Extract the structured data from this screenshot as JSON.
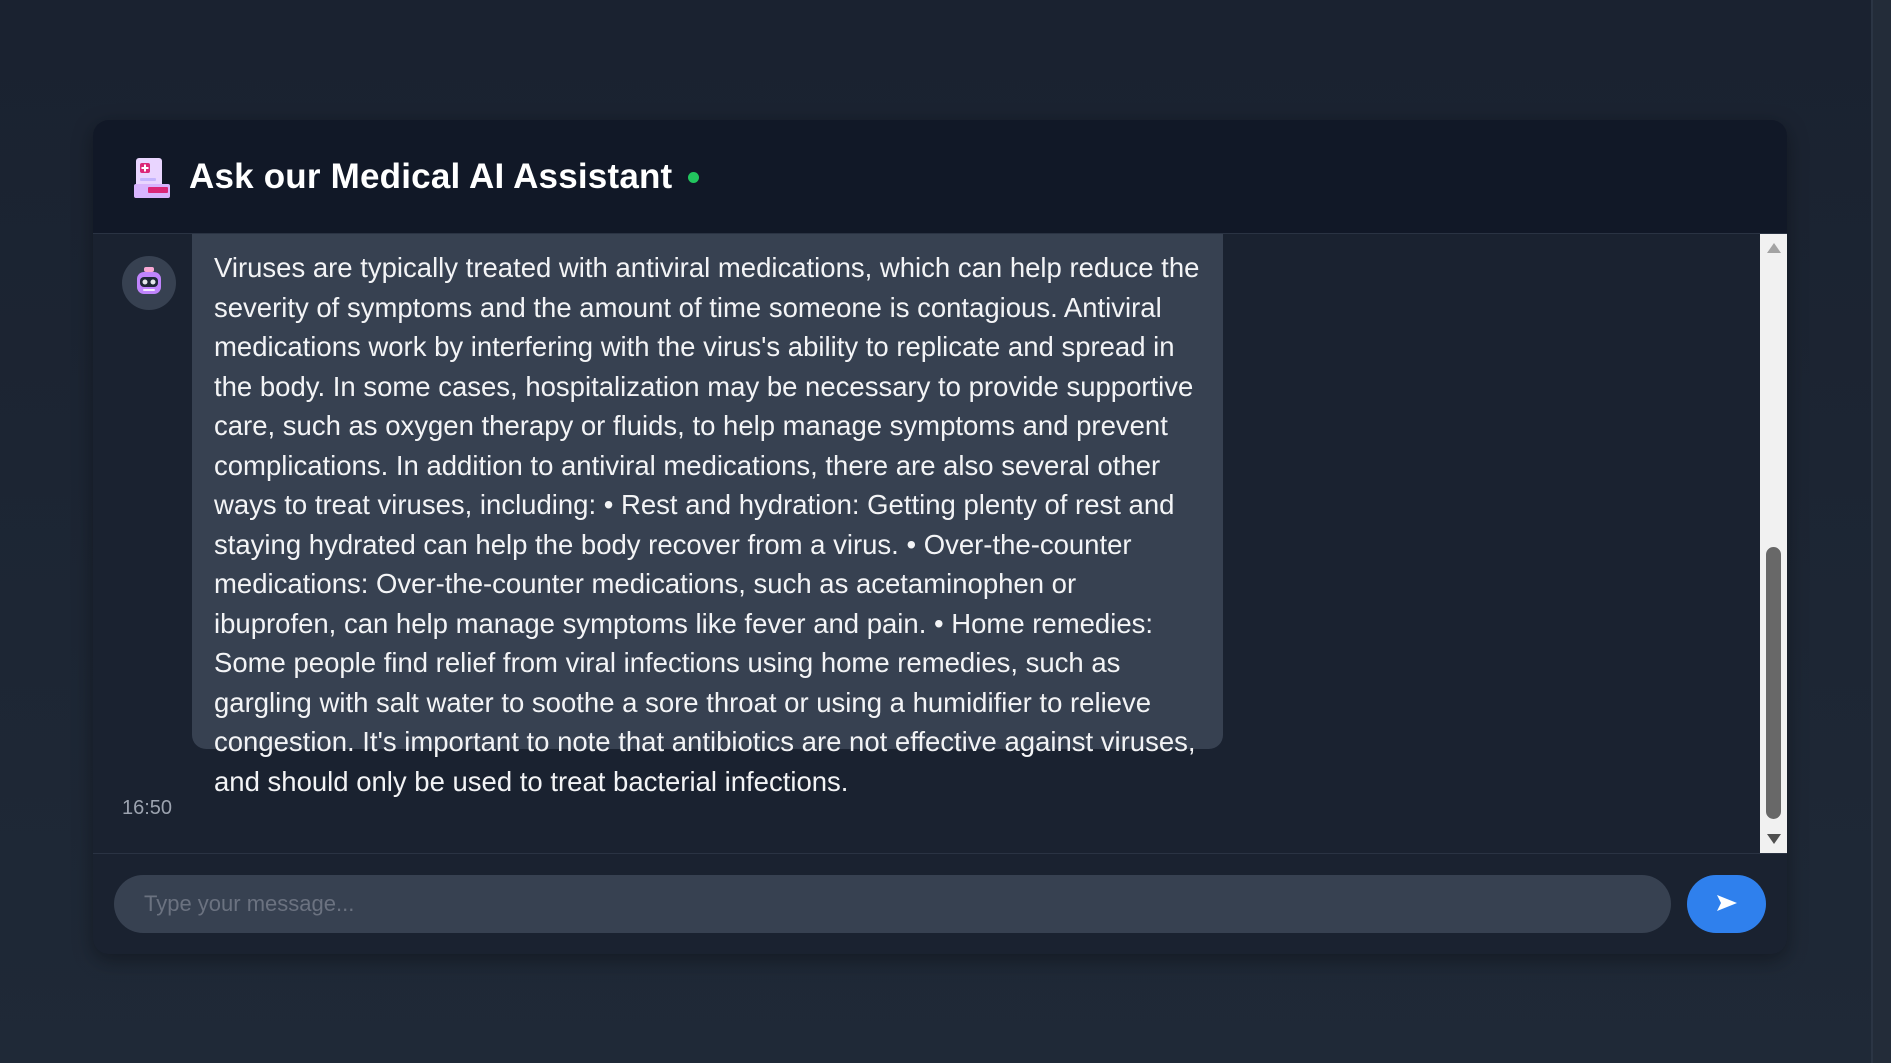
{
  "header": {
    "title": "Ask our Medical AI Assistant",
    "icon": "medical-kit-icon",
    "status": "online",
    "status_color": "#22c55e"
  },
  "conversation": {
    "messages": [
      {
        "sender": "assistant",
        "avatar_icon": "robot-icon",
        "text": "Viruses are typically treated with antiviral medications, which can help reduce the severity of symptoms and the amount of time someone is contagious. Antiviral medications work by interfering with the virus's ability to replicate and spread in the body. In some cases, hospitalization may be necessary to provide supportive care, such as oxygen therapy or fluids, to help manage symptoms and prevent complications. In addition to antiviral medications, there are also several other ways to treat viruses, including: • Rest and hydration: Getting plenty of rest and staying hydrated can help the body recover from a virus. • Over-the-counter medications: Over-the-counter medications, such as acetaminophen or ibuprofen, can help manage symptoms like fever and pain. • Home remedies: Some people find relief from viral infections using home remedies, such as gargling with salt water to soothe a sore throat or using a humidifier to relieve congestion. It's important to note that antibiotics are not effective against viruses, and should only be used to treat bacterial infections.",
        "time": "16:50"
      }
    ]
  },
  "composer": {
    "placeholder": "Type your message...",
    "send_icon": "send-arrow-icon",
    "accent_color": "#2f80ed"
  }
}
